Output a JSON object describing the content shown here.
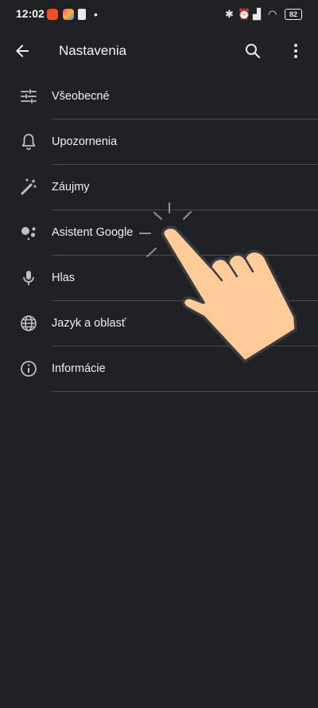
{
  "status_bar": {
    "time": "12:02",
    "battery": "82"
  },
  "app_bar": {
    "title": "Nastavenia"
  },
  "settings": [
    {
      "label": "Všeobecné",
      "icon": "tune-icon"
    },
    {
      "label": "Upozornenia",
      "icon": "bell-icon"
    },
    {
      "label": "Záujmy",
      "icon": "magic-wand-icon"
    },
    {
      "label": "Asistent Google",
      "icon": "google-assistant-icon"
    },
    {
      "label": "Hlas",
      "icon": "microphone-icon"
    },
    {
      "label": "Jazyk a oblasť",
      "icon": "globe-icon"
    },
    {
      "label": "Informácie",
      "icon": "info-icon"
    }
  ],
  "colors": {
    "background": "#202124",
    "text": "#eceff1",
    "icon": "#bdc1c6",
    "divider": "#4a4c50",
    "hand_fill": "#ffcc99"
  }
}
